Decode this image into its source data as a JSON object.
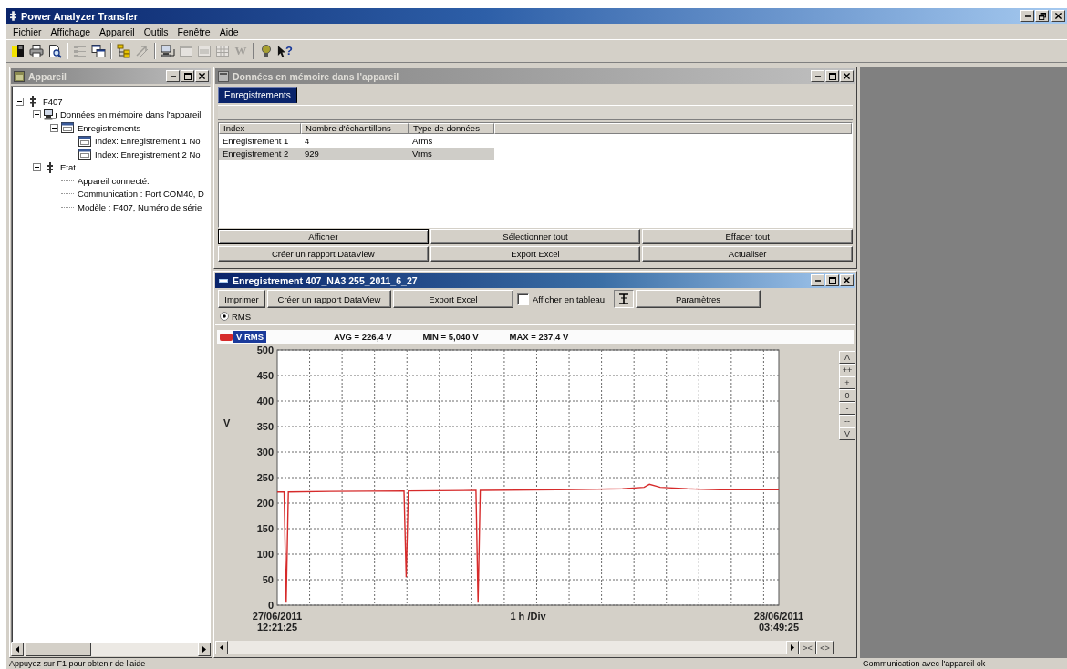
{
  "window": {
    "title": "Power Analyzer Transfer"
  },
  "menu": [
    "Fichier",
    "Affichage",
    "Appareil",
    "Outils",
    "Fenêtre",
    "Aide"
  ],
  "toolbar": [
    [
      {
        "kind": "meter",
        "disabled": false
      },
      {
        "kind": "print",
        "disabled": false
      },
      {
        "kind": "preview",
        "disabled": false
      }
    ],
    [
      {
        "kind": "list",
        "disabled": true
      },
      {
        "kind": "windows",
        "disabled": false
      }
    ],
    [
      {
        "kind": "tree",
        "disabled": false
      },
      {
        "kind": "arrows",
        "disabled": true
      }
    ],
    [
      {
        "kind": "computer",
        "disabled": false
      },
      {
        "kind": "window",
        "disabled": true
      },
      {
        "kind": "panel",
        "disabled": true
      },
      {
        "kind": "grid",
        "disabled": true
      },
      {
        "kind": "letter",
        "label": "W",
        "disabled": true
      }
    ],
    [
      {
        "kind": "bulb",
        "disabled": false
      },
      {
        "kind": "help",
        "label": "?",
        "disabled": false
      }
    ]
  ],
  "device_panel": {
    "title": "Appareil",
    "tree": [
      {
        "label": "F407",
        "kind": "device",
        "expanded": true,
        "children": [
          {
            "label": "Données en mémoire dans l'appareil",
            "kind": "memory",
            "expanded": true,
            "children": [
              {
                "label": "Enregistrements",
                "kind": "records",
                "expanded": true,
                "children": [
                  {
                    "label": "Index: Enregistrement 1 No",
                    "kind": "record"
                  },
                  {
                    "label": "Index: Enregistrement 2 No",
                    "kind": "record"
                  }
                ]
              }
            ]
          },
          {
            "label": "Etat",
            "kind": "device",
            "expanded": true,
            "children": [
              {
                "label": "Appareil connecté.",
                "kind": "info"
              },
              {
                "label": "Communication : Port COM40, D",
                "kind": "info"
              },
              {
                "label": "Modèle : F407, Numéro de série",
                "kind": "info"
              }
            ]
          }
        ]
      }
    ]
  },
  "memory_window": {
    "title": "Données en mémoire dans l'appareil",
    "tabs": [
      {
        "label": "Enregistrements",
        "selected": true
      }
    ],
    "table": {
      "columns": [
        "Index",
        "Nombre d'échantillons",
        "Type de données"
      ],
      "rows": [
        {
          "cells": [
            "Enregistrement 1",
            "4",
            "Arms"
          ],
          "selected": false
        },
        {
          "cells": [
            "Enregistrement 2",
            "929",
            "Vrms"
          ],
          "selected": true
        }
      ]
    },
    "buttons": [
      {
        "label": "Afficher",
        "default": true
      },
      {
        "label": "Sélectionner tout",
        "default": false
      },
      {
        "label": "Effacer tout",
        "default": false
      },
      {
        "label": "Créer un rapport DataView",
        "default": false
      },
      {
        "label": "Export Excel",
        "default": false
      },
      {
        "label": "Actualiser",
        "default": false
      }
    ]
  },
  "record_window": {
    "title": "Enregistrement 407_NA3 255_2011_6_27",
    "toolbar": [
      {
        "kind": "button",
        "label": "Imprimer"
      },
      {
        "kind": "button",
        "label": "Créer un rapport DataView"
      },
      {
        "kind": "button",
        "label": "Export Excel"
      },
      {
        "kind": "checkbox",
        "label": "Afficher en tableau",
        "checked": false
      },
      {
        "kind": "icon"
      },
      {
        "kind": "button",
        "label": "Paramètres"
      }
    ],
    "modes": [
      {
        "label": "RMS",
        "selected": true
      }
    ],
    "trace": {
      "label": "V RMS",
      "selected": true,
      "stats": [
        "AVG = 226,4 V",
        "MIN = 5,040 V",
        "MAX = 237,4 V"
      ]
    },
    "chart_data": {
      "type": "line",
      "xlabel": "1 h /Div",
      "ylabel": "V",
      "color": "#d62b2b",
      "grid": true,
      "xlim": [
        "2011-06-27T12:21:25",
        "2011-06-28T03:49:25"
      ],
      "ylim": [
        0,
        500
      ],
      "xticks": [
        {
          "value": "2011-06-27T12:21:25",
          "label": "27/06/2011 12:21:25"
        },
        {
          "value": "2011-06-28T03:49:25",
          "label": "28/06/2011 03:49:25"
        }
      ],
      "yticks": [
        0,
        50,
        100,
        150,
        200,
        250,
        300,
        350,
        400,
        450,
        500
      ],
      "x": [
        "2011-06-27T12:21:25",
        "2011-06-27T12:34:00",
        "2011-06-27T12:38:00",
        "2011-06-27T12:42:00",
        "2011-06-27T14:00:00",
        "2011-06-27T16:16:00",
        "2011-06-27T16:20:00",
        "2011-06-27T16:24:00",
        "2011-06-27T18:29:00",
        "2011-06-27T18:33:00",
        "2011-06-27T18:37:00",
        "2011-06-27T21:00:00",
        "2011-06-27T23:00:00",
        "2011-06-27T23:40:00",
        "2011-06-27T23:50:00",
        "2011-06-28T00:10:00",
        "2011-06-28T01:00:00",
        "2011-06-28T02:00:00",
        "2011-06-28T03:49:25"
      ],
      "values": [
        222,
        222,
        5,
        222,
        223,
        224,
        55,
        224,
        225,
        5,
        225,
        226,
        228,
        231,
        237,
        231,
        228,
        226,
        226
      ]
    },
    "zoom_buttons": [
      "Λ",
      "++",
      "+",
      "0",
      "-",
      "--",
      "V"
    ],
    "scroll_buttons": [
      "><",
      "<>"
    ]
  },
  "status_bar": {
    "left": "Appuyez sur F1 pour obtenir de l'aide",
    "right": "Communication avec l'appareil ok"
  }
}
